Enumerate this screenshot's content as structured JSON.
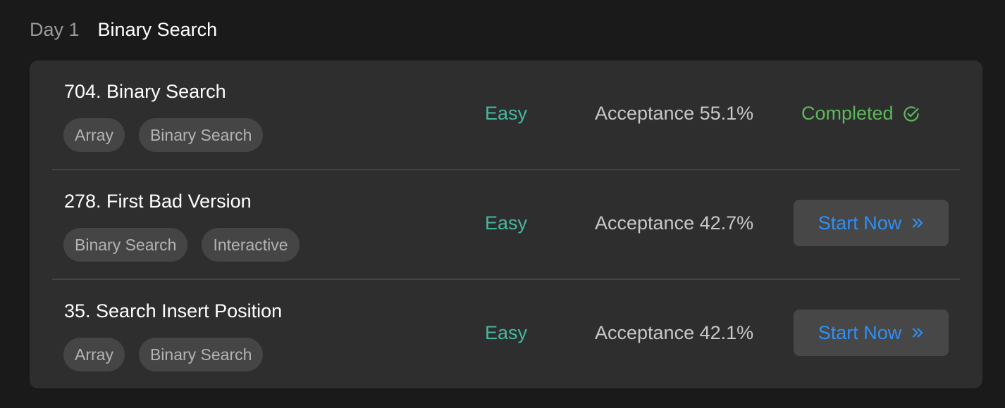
{
  "day": {
    "label": "Day 1",
    "title": "Binary Search"
  },
  "problems": [
    {
      "title": "704. Binary Search",
      "tags": [
        "Array",
        "Binary Search"
      ],
      "difficulty": "Easy",
      "acceptance": "Acceptance 55.1%",
      "status": "Completed",
      "status_icon": "check-circle-icon"
    },
    {
      "title": "278. First Bad Version",
      "tags": [
        "Binary Search",
        "Interactive"
      ],
      "difficulty": "Easy",
      "acceptance": "Acceptance 42.7%",
      "action_label": "Start Now",
      "action_icon": "double-chevron-right-icon"
    },
    {
      "title": "35. Search Insert Position",
      "tags": [
        "Array",
        "Binary Search"
      ],
      "difficulty": "Easy",
      "acceptance": "Acceptance 42.1%",
      "action_label": "Start Now",
      "action_icon": "double-chevron-right-icon"
    }
  ],
  "colors": {
    "background": "#1a1a1a",
    "card": "#2e2e2e",
    "easy": "#46b8a1",
    "completed": "#5cb85c",
    "action": "#2f8ff5"
  }
}
